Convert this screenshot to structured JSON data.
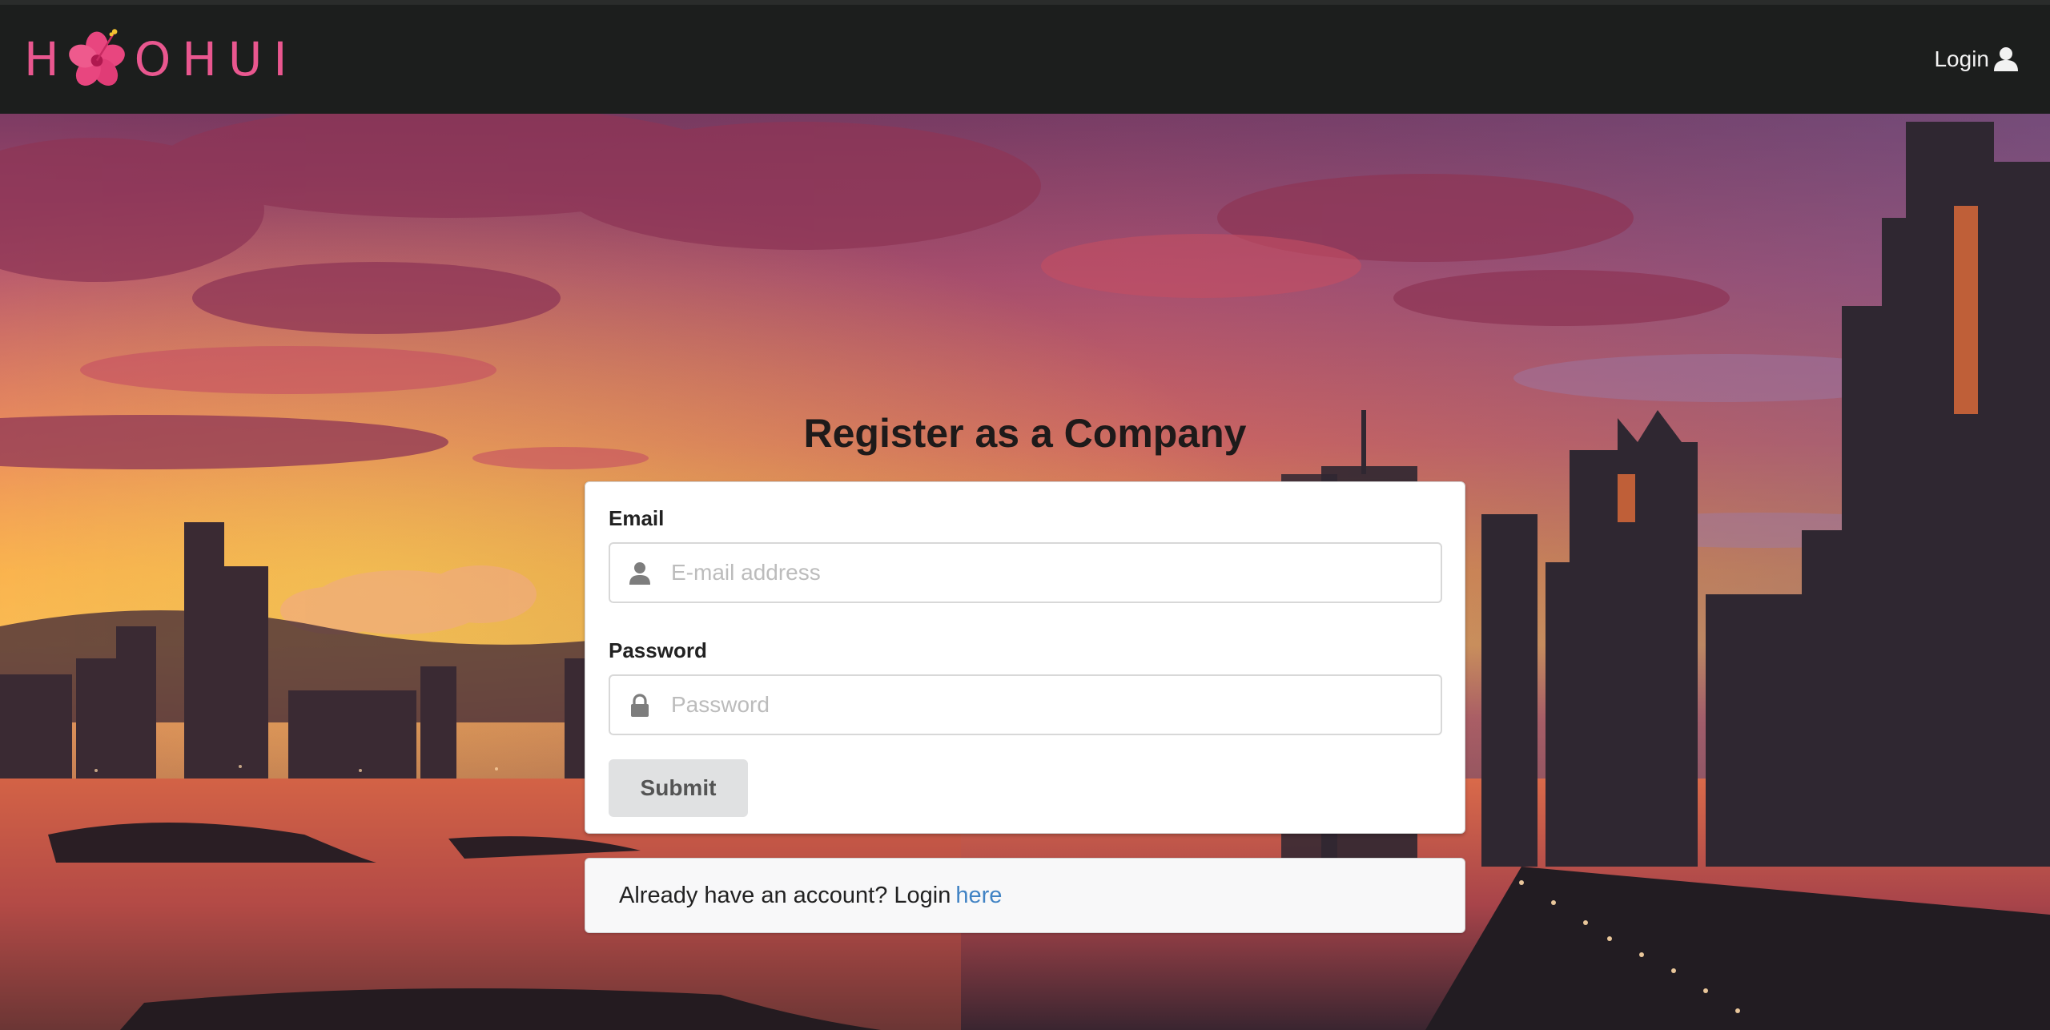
{
  "header": {
    "logo_text_first": "H",
    "logo_text_rest": "OHUI",
    "login_label": "Login",
    "logo_color": "#e9578f",
    "bar_color": "#1c1e1d"
  },
  "icons": {
    "logo": "hibiscus-flower-icon",
    "login": "user-icon",
    "email": "user-icon",
    "password": "lock-icon"
  },
  "form": {
    "title": "Register as a Company",
    "email_label": "Email",
    "email_placeholder": "E-mail address",
    "email_value": "",
    "password_label": "Password",
    "password_placeholder": "Password",
    "password_value": "",
    "submit_label": "Submit"
  },
  "footer_message": {
    "text": "Already have an account? Login",
    "link_text": "here",
    "link_color": "#4183c4"
  }
}
